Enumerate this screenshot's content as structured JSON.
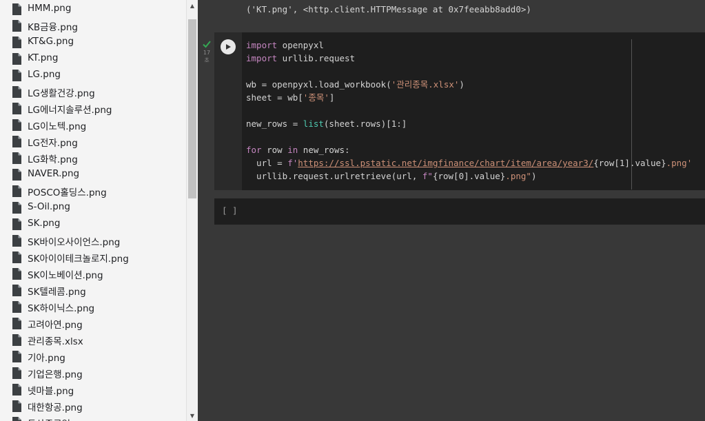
{
  "files": [
    "HMM.png",
    "KB금융.png",
    "KT&G.png",
    "KT.png",
    "LG.png",
    "LG생활건강.png",
    "LG에너지솔루션.png",
    "LG이노텍.png",
    "LG전자.png",
    "LG화학.png",
    "NAVER.png",
    "POSCO홀딩스.png",
    "S-Oil.png",
    "SK.png",
    "SK바이오사이언스.png",
    "SK아이이테크놀로지.png",
    "SK이노베이션.png",
    "SK텔레콤.png",
    "SK하이닉스.png",
    "고려아연.png",
    "관리종목.xlsx",
    "기아.png",
    "기업은행.png",
    "넷마블.png",
    "대한항공.png",
    "두산중공업.png"
  ],
  "output": {
    "text": "('KT.png', <http.client.HTTPMessage at 0x7feeabb8add0>)"
  },
  "code_cell": {
    "exec_time": "17\n초",
    "status": "success",
    "lines": {
      "l1_kw": "import",
      "l1_rest": " openpyxl",
      "l2_kw": "import",
      "l2_rest": " urllib.request",
      "l4_a": "wb = openpyxl.load_workbook(",
      "l4_str": "'관리종목.xlsx'",
      "l4_b": ")",
      "l5_a": "sheet = wb[",
      "l5_str": "'종목'",
      "l5_b": "]",
      "l7_a": "new_rows = ",
      "l7_fn": "list",
      "l7_b": "(sheet.rows)[1:]",
      "l9_kw1": "for",
      "l9_a": " row ",
      "l9_kw2": "in",
      "l9_b": " new_rows:",
      "l10_a": "  url = ",
      "l10_f": "f'",
      "l10_url": "https://ssl.pstatic.net/imgfinance/chart/item/area/year3/",
      "l10_expr": "{row[1].value}",
      "l10_str": ".png'",
      "l11_a": "  urllib.request.urlretrieve(url, ",
      "l11_f": "f\"",
      "l11_expr": "{row[0].value}",
      "l11_str": ".png\"",
      "l11_b": ")"
    }
  },
  "empty_cell": {
    "prompt": "[ ]"
  }
}
